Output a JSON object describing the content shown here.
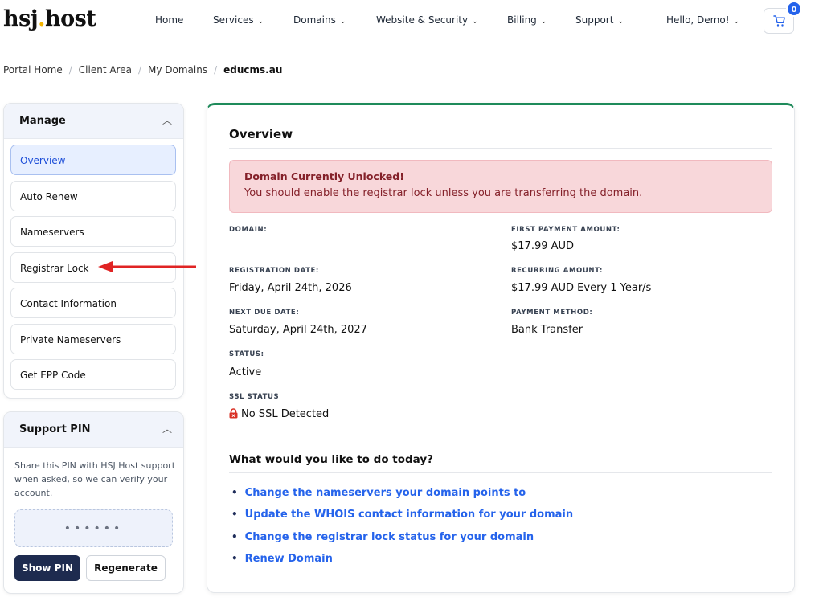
{
  "brand": {
    "name_left": "hsj",
    "name_dot": ".",
    "name_right": "host"
  },
  "nav": {
    "home": "Home",
    "services": "Services",
    "domains": "Domains",
    "website_security": "Website & Security",
    "billing": "Billing",
    "support": "Support",
    "user": "Hello, Demo!",
    "cart_count": "0"
  },
  "breadcrumb": {
    "items": [
      "Portal Home",
      "Client Area",
      "My Domains"
    ],
    "current": "educms.au"
  },
  "sidebar": {
    "manage_title": "Manage",
    "items": [
      "Overview",
      "Auto Renew",
      "Nameservers",
      "Registrar Lock",
      "Contact Information",
      "Private Nameservers",
      "Get EPP Code"
    ],
    "active_item": "Overview"
  },
  "support_pin": {
    "title": "Support PIN",
    "description": "Share this PIN with HSJ Host support when asked, so we can verify your account.",
    "masked": "••••••",
    "show_label": "Show PIN",
    "regenerate_label": "Regenerate"
  },
  "overview": {
    "title": "Overview",
    "alert_title": "Domain Currently Unlocked!",
    "alert_text": "You should enable the registrar lock unless you are transferring the domain.",
    "domain_label": "DOMAIN:",
    "registration_label": "REGISTRATION DATE:",
    "registration_value": "Friday, April 24th, 2026",
    "next_due_label": "NEXT DUE DATE:",
    "next_due_value": "Saturday, April 24th, 2027",
    "status_label": "STATUS:",
    "status_value": "Active",
    "ssl_label": "SSL STATUS",
    "ssl_value": "No SSL Detected",
    "first_payment_label": "FIRST PAYMENT AMOUNT:",
    "first_payment_value": "$17.99 AUD",
    "recurring_label": "RECURRING AMOUNT:",
    "recurring_value": "$17.99 AUD Every 1 Year/s",
    "payment_method_label": "PAYMENT METHOD:",
    "payment_method_value": "Bank Transfer"
  },
  "actions": {
    "title": "What would you like to do today?",
    "links": [
      "Change the nameservers your domain points to",
      "Update the WHOIS contact information for your domain",
      "Change the registrar lock status for your domain",
      "Renew Domain"
    ]
  },
  "colors": {
    "accent_blue": "#2563eb",
    "alert_bg": "#f8d7da",
    "alert_text": "#842029",
    "card_top_border": "#1e8a5a",
    "annotation_arrow": "#e02424"
  }
}
